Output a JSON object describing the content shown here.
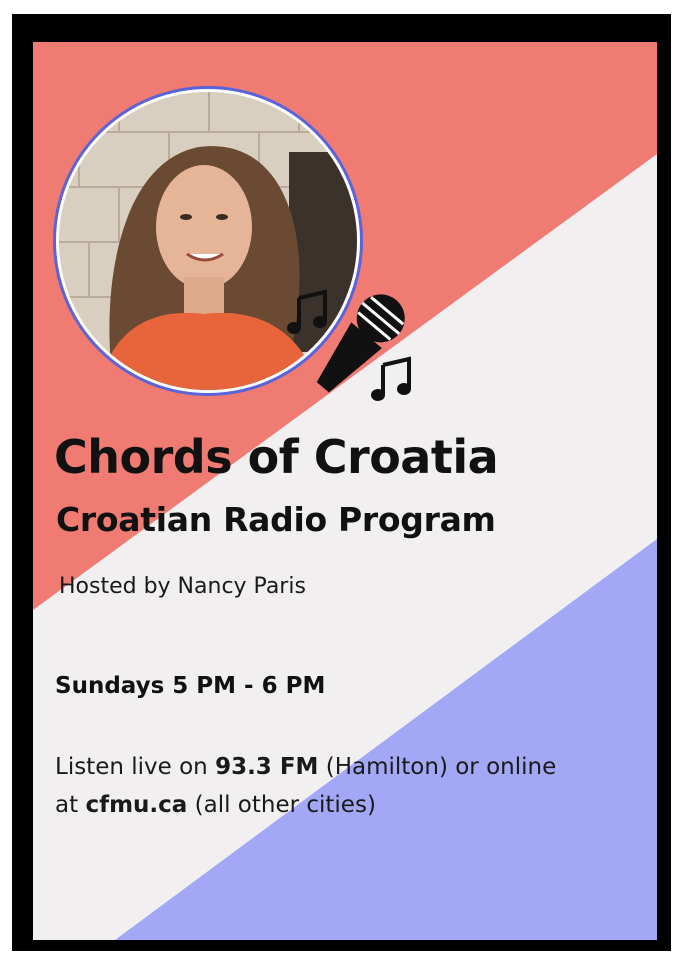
{
  "poster": {
    "title": "Chords of Croatia",
    "subtitle": "Croatian Radio Program",
    "host": "Hosted by Nancy Paris",
    "schedule": "Sundays 5 PM - 6 PM",
    "listen": {
      "line1_prefix": "Listen live on ",
      "frequency": "93.3 FM",
      "line1_suffix": " (Hamilton) or online",
      "line2_prefix": "at ",
      "website": "cfmu.ca",
      "line2_suffix": " (all other cities)"
    }
  },
  "colors": {
    "frame": "#000000",
    "red_band": "#ef7b72",
    "white_band": "#f1efef",
    "blue_band": "#a2a8f5",
    "photo_ring": "#5b63d8"
  },
  "icons": {
    "microphone": "microphone-icon",
    "music_notes": "music-note-icon"
  }
}
